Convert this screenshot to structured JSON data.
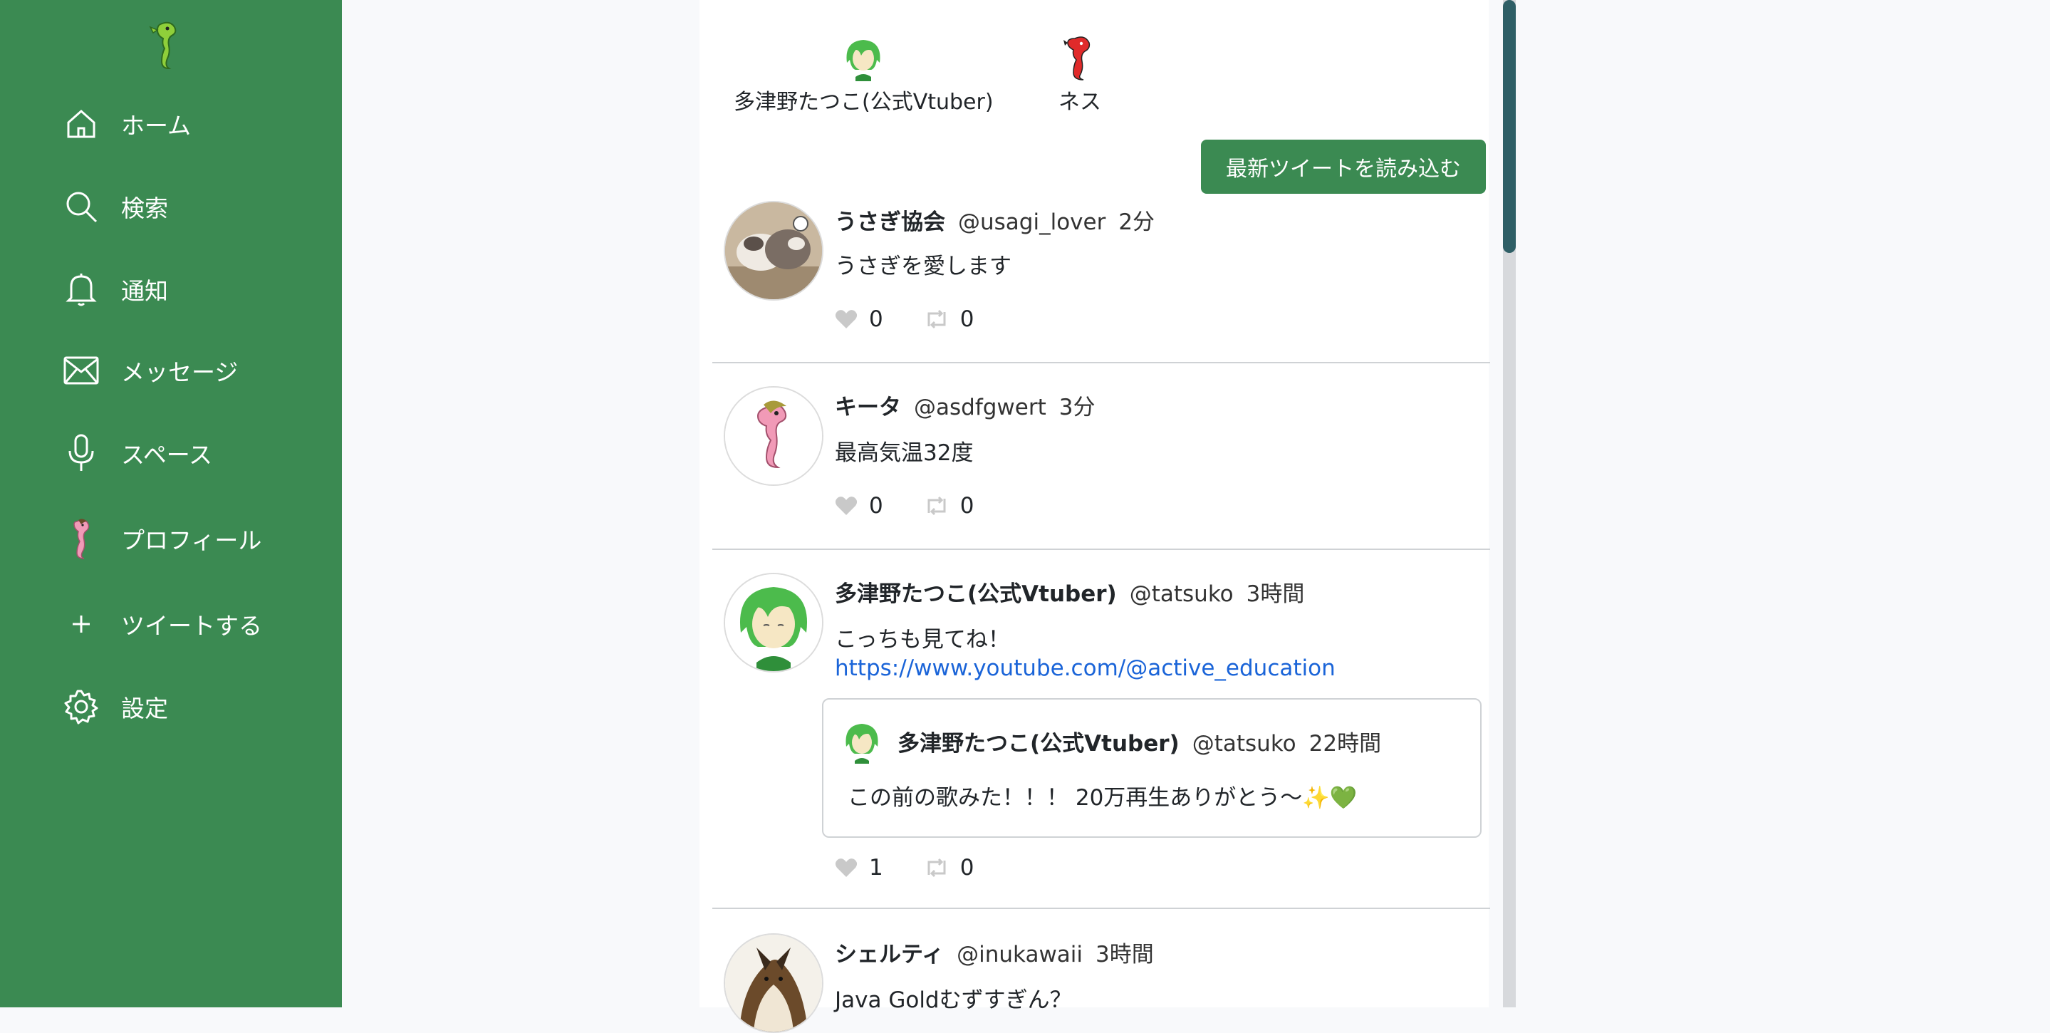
{
  "sidebar": {
    "items": [
      {
        "label": "ホーム",
        "icon": "home-icon"
      },
      {
        "label": "検索",
        "icon": "search-icon"
      },
      {
        "label": "通知",
        "icon": "bell-icon"
      },
      {
        "label": "メッセージ",
        "icon": "mail-icon"
      },
      {
        "label": "スペース",
        "icon": "mic-icon"
      },
      {
        "label": "プロフィール",
        "icon": "avatar-icon"
      },
      {
        "label": "ツイートする",
        "icon": "plus-icon"
      },
      {
        "label": "設定",
        "icon": "gear-icon"
      }
    ]
  },
  "following": [
    {
      "name": "多津野たつこ(公式Vtuber)"
    },
    {
      "name": "ネス"
    }
  ],
  "load_button": "最新ツイートを読み込む",
  "tweets": [
    {
      "name": "うさぎ協会",
      "handle": "@usagi_lover",
      "time": "2分",
      "text": "うさぎを愛します",
      "likes": "0",
      "retweets": "0"
    },
    {
      "name": "キータ",
      "handle": "@asdfgwert",
      "time": "3分",
      "text": "最高気温32度",
      "likes": "0",
      "retweets": "0"
    },
    {
      "name": "多津野たつこ(公式Vtuber)",
      "handle": "@tatsuko",
      "time": "3時間",
      "text": "こっちも見てね！",
      "link": "https://www.youtube.com/@active_education",
      "likes": "1",
      "retweets": "0",
      "quote": {
        "name": "多津野たつこ(公式Vtuber)",
        "handle": "@tatsuko",
        "time": "22時間",
        "text": "この前の歌みた！！！ 20万再生ありがとう〜✨💚"
      }
    },
    {
      "name": "シェルティ",
      "handle": "@inukawaii",
      "time": "3時間",
      "text": "Java Goldむずすぎん？"
    }
  ],
  "colors": {
    "sidebar": "#3b8a52",
    "link": "#1a64d8",
    "scroll_thumb": "#2f5f66"
  }
}
